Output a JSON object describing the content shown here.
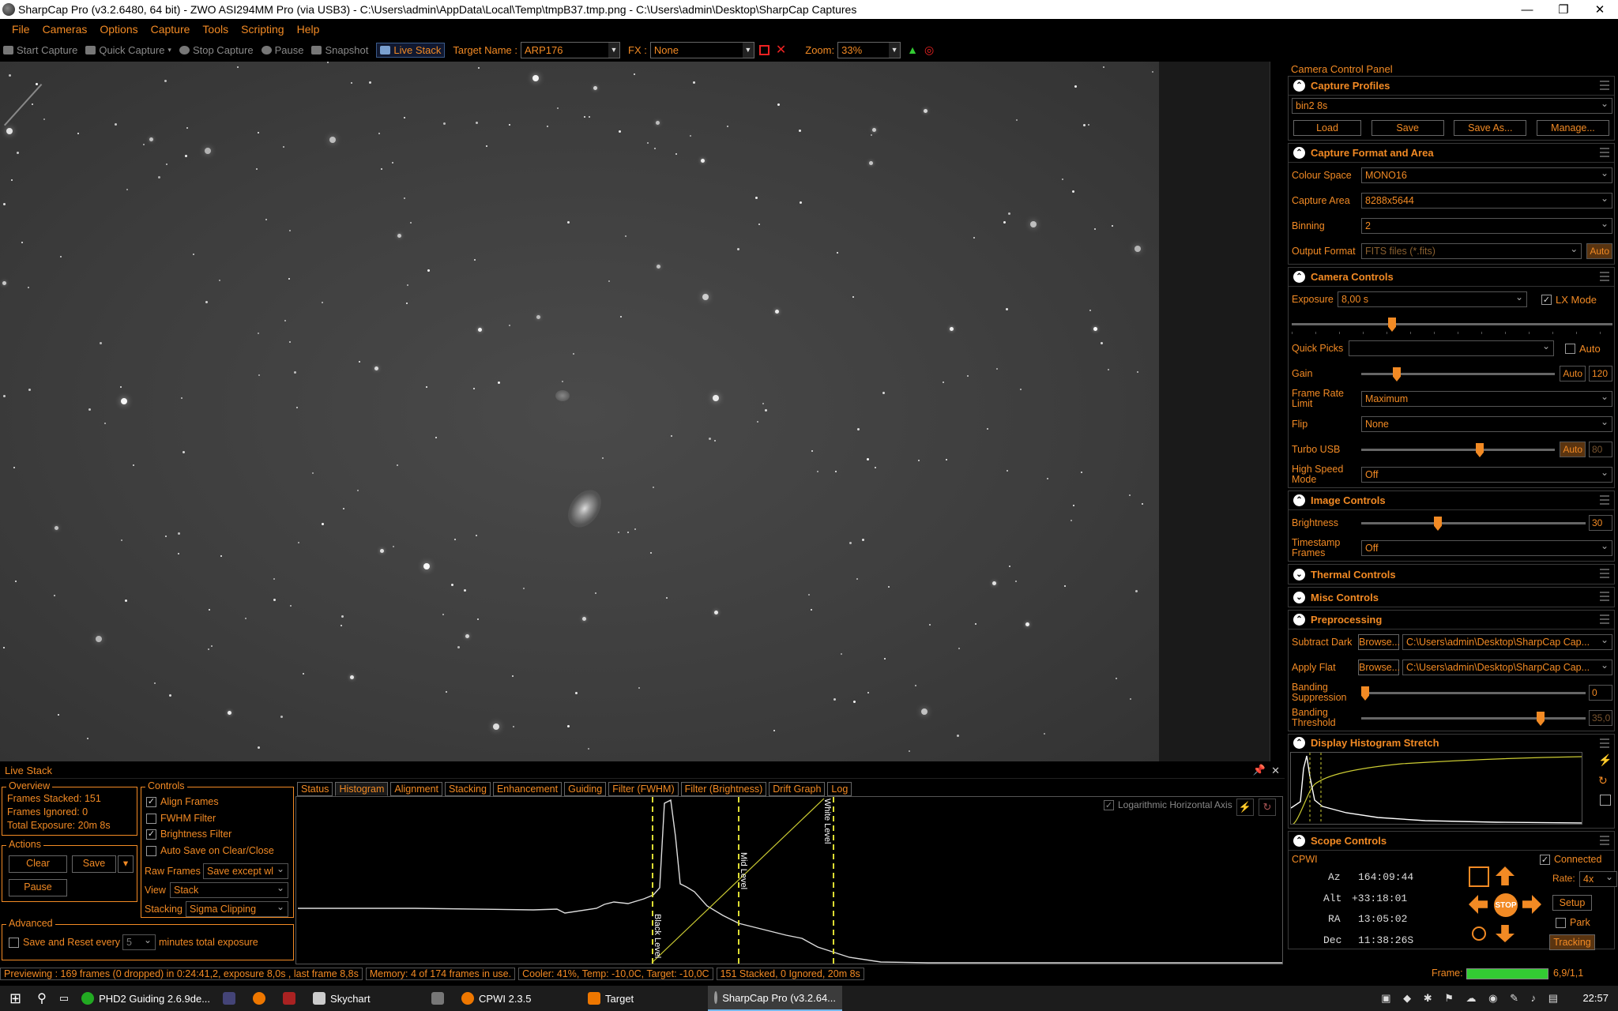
{
  "window": {
    "title": "SharpCap Pro (v3.2.6480, 64 bit) - ZWO ASI294MM Pro (via USB3) - C:\\Users\\admin\\AppData\\Local\\Temp\\tmpB37.tmp.png - C:\\Users\\admin\\Desktop\\SharpCap Captures"
  },
  "menu": [
    "File",
    "Cameras",
    "Options",
    "Capture",
    "Tools",
    "Scripting",
    "Help"
  ],
  "toolbar": {
    "start_capture": "Start Capture",
    "quick_capture": "Quick Capture",
    "stop_capture": "Stop Capture",
    "pause": "Pause",
    "snapshot": "Snapshot",
    "live_stack": "Live Stack",
    "target_label": "Target Name :",
    "target_value": "ARP176",
    "fx_label": "FX :",
    "fx_value": "None",
    "zoom_label": "Zoom:",
    "zoom_value": "33%"
  },
  "ccp": {
    "title": "Camera Control Panel",
    "capture_profiles": {
      "header": "Capture Profiles",
      "profile": "bin2 8s",
      "load": "Load",
      "save": "Save",
      "save_as": "Save As...",
      "manage": "Manage..."
    },
    "format": {
      "header": "Capture Format and Area",
      "colour_space_label": "Colour Space",
      "colour_space": "MONO16",
      "capture_area_label": "Capture Area",
      "capture_area": "8288x5644",
      "binning_label": "Binning",
      "binning": "2",
      "output_format_label": "Output Format",
      "output_format": "FITS files (*.fits)",
      "auto": "Auto"
    },
    "camera": {
      "header": "Camera Controls",
      "exposure_label": "Exposure",
      "exposure": "8,00 s",
      "lx_mode": "LX Mode",
      "quick_picks_label": "Quick Picks",
      "auto": "Auto",
      "gain_label": "Gain",
      "gain_value": "120",
      "frame_rate_label": "Frame Rate Limit",
      "frame_rate": "Maximum",
      "flip_label": "Flip",
      "flip": "None",
      "turbo_label": "Turbo USB",
      "turbo_value": "80",
      "hsm_label": "High Speed Mode",
      "hsm": "Off"
    },
    "image": {
      "header": "Image Controls",
      "brightness_label": "Brightness",
      "brightness": "30",
      "timestamp_label": "Timestamp Frames",
      "timestamp": "Off"
    },
    "thermal": {
      "header": "Thermal Controls"
    },
    "misc": {
      "header": "Misc Controls"
    },
    "pre": {
      "header": "Preprocessing",
      "subtract_dark_label": "Subtract Dark",
      "apply_flat_label": "Apply Flat",
      "browse": "Browse...",
      "dark_path": "C:\\Users\\admin\\Desktop\\SharpCap Cap...",
      "flat_path": "C:\\Users\\admin\\Desktop\\SharpCap Cap...",
      "banding_supp_label": "Banding Suppression",
      "banding_supp": "0",
      "banding_thr_label": "Banding Threshold",
      "banding_thr": "35,0"
    },
    "histstretch": {
      "header": "Display Histogram Stretch"
    },
    "scope": {
      "header": "Scope Controls",
      "name": "CPWI",
      "connected": "Connected",
      "az_label": "Az",
      "az": "164:09:44",
      "alt_label": "Alt",
      "alt": "+33:18:01",
      "ra_label": "RA",
      "ra": "13:05:02",
      "dec_label": "Dec",
      "dec": "11:38:26S",
      "rate_label": "Rate:",
      "rate": "4x",
      "setup": "Setup",
      "park": "Park",
      "stop": "STOP",
      "tracking": "Tracking"
    }
  },
  "livestack": {
    "title": "Live Stack",
    "overview": {
      "legend": "Overview",
      "stacked": "Frames Stacked:  151",
      "ignored": "Frames Ignored:  0",
      "total": "Total Exposure:   20m 8s"
    },
    "actions": {
      "legend": "Actions",
      "clear": "Clear",
      "save": "Save",
      "pause": "Pause"
    },
    "controls": {
      "legend": "Controls",
      "align": "Align Frames",
      "fwhm": "FWHM Filter",
      "brightness": "Brightness Filter",
      "autosave": "Auto Save on Clear/Close",
      "raw_label": "Raw Frames",
      "raw": "Save except wl",
      "view_label": "View",
      "view": "Stack",
      "stacking_label": "Stacking",
      "stacking": "Sigma Clipping"
    },
    "advanced": {
      "legend": "Advanced",
      "save_reset": "Save and Reset every",
      "minutes": "5",
      "suffix": "minutes total exposure"
    },
    "tabs": [
      "Status",
      "Histogram",
      "Alignment",
      "Stacking",
      "Enhancement",
      "Guiding",
      "Filter (FWHM)",
      "Filter (Brightness)",
      "Drift Graph",
      "Log"
    ],
    "log_axis": "Logarithmic Horizontal Axis",
    "black_level": "Black Level",
    "mid_level": "Mid Level",
    "white_level": "White Level"
  },
  "status": {
    "previewing": "Previewing : 169 frames (0 dropped) in 0:24:41,2, exposure 8,0s , last frame 8,8s",
    "memory": "Memory: 4 of 174 frames in use.",
    "cooler": "Cooler: 41%, Temp: -10,0C, Target: -10,0C",
    "stacked": "151 Stacked, 0 Ignored, 20m 8s",
    "frame_label": "Frame:",
    "frame_value": "6,9/1,1"
  },
  "taskbar": {
    "items": [
      "PHD2 Guiding 2.6.9de...",
      "Skychart",
      "CPWI 2.3.5",
      "Target",
      "SharpCap Pro (v3.2.64..."
    ],
    "time": "22:57"
  }
}
